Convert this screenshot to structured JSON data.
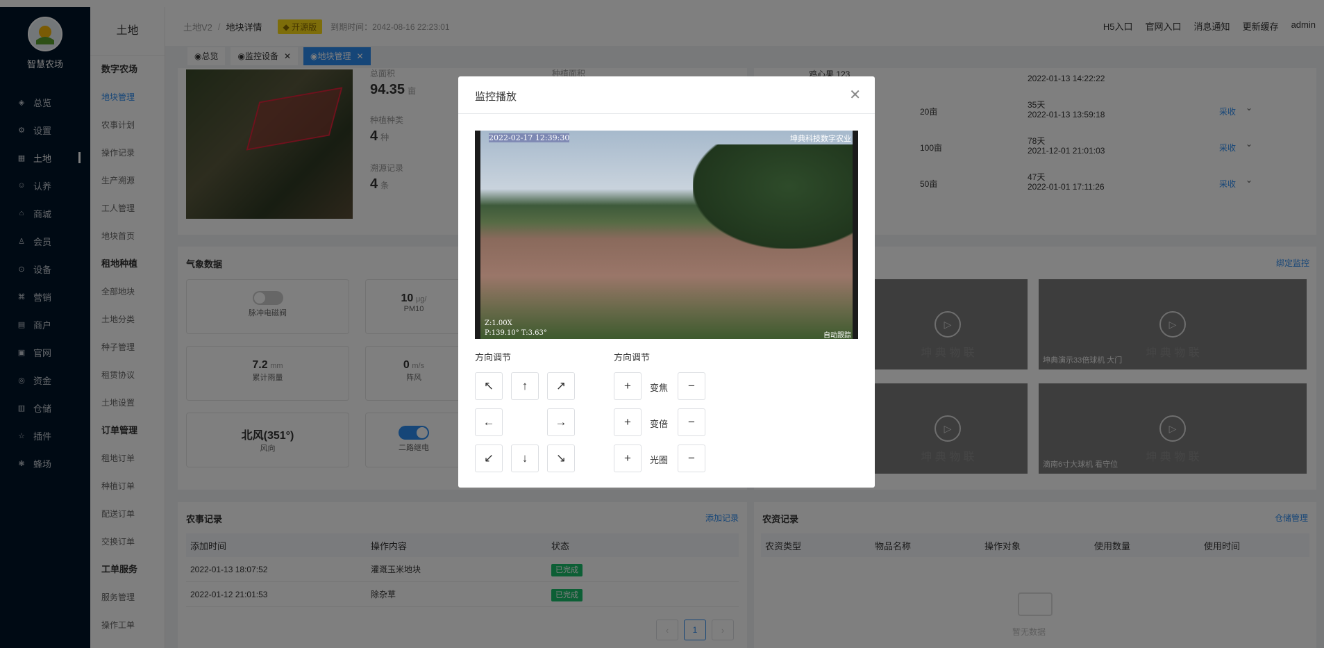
{
  "app": {
    "name": "智慧农场"
  },
  "sidebar": {
    "items": [
      {
        "label": "总览",
        "icon": "dashboard-icon"
      },
      {
        "label": "设置",
        "icon": "gear-icon"
      },
      {
        "label": "土地",
        "icon": "grid-icon"
      },
      {
        "label": "认养",
        "icon": "adopt-icon"
      },
      {
        "label": "商城",
        "icon": "shop-icon"
      },
      {
        "label": "会员",
        "icon": "member-icon"
      },
      {
        "label": "设备",
        "icon": "device-icon"
      },
      {
        "label": "营销",
        "icon": "marketing-icon"
      },
      {
        "label": "商户",
        "icon": "merchant-icon"
      },
      {
        "label": "官网",
        "icon": "website-icon"
      },
      {
        "label": "资金",
        "icon": "fund-icon"
      },
      {
        "label": "仓储",
        "icon": "storage-icon"
      },
      {
        "label": "插件",
        "icon": "star-icon"
      },
      {
        "label": "蜂场",
        "icon": "bee-icon"
      }
    ]
  },
  "subnav": {
    "title": "土地",
    "items": [
      {
        "label": "数字农场",
        "head": true
      },
      {
        "label": "地块管理",
        "active": true
      },
      {
        "label": "农事计划"
      },
      {
        "label": "操作记录"
      },
      {
        "label": "生产溯源"
      },
      {
        "label": "工人管理"
      },
      {
        "label": "地块首页"
      },
      {
        "label": "租地种植",
        "head": true
      },
      {
        "label": "全部地块"
      },
      {
        "label": "土地分类"
      },
      {
        "label": "种子管理"
      },
      {
        "label": "租赁协议"
      },
      {
        "label": "土地设置"
      },
      {
        "label": "订单管理",
        "head": true
      },
      {
        "label": "租地订单"
      },
      {
        "label": "种植订单"
      },
      {
        "label": "配送订单"
      },
      {
        "label": "交换订单"
      },
      {
        "label": "工单服务",
        "head": true
      },
      {
        "label": "服务管理"
      },
      {
        "label": "操作工单"
      }
    ]
  },
  "header": {
    "crumb_root": "土地V2",
    "crumb_sep": "/",
    "crumb_current": "地块详情",
    "edition": "开源版",
    "expire": "到期时间：2042-08-16 22:23:01",
    "links": [
      "H5入口",
      "官网入口",
      "消息通知",
      "更新缓存",
      "admin"
    ]
  },
  "tabs": [
    {
      "label": "◉总览"
    },
    {
      "label": "◉监控设备",
      "close": "✕"
    },
    {
      "label": "◉地块管理",
      "close": "✕",
      "active": true
    }
  ],
  "land": {
    "area_label": "总面积",
    "area_value": "94.35",
    "area_unit": "亩",
    "crop_label": "种植种类",
    "crop_value": "4",
    "crop_unit": "种",
    "trace_label": "溯源记录",
    "trace_value": "4",
    "trace_unit": "条",
    "plant_label": "种植面积"
  },
  "crops": {
    "rows": [
      {
        "name": "鸡心果 123",
        "area": "",
        "days": "",
        "time": "2022-01-13 14:22:22",
        "action": ""
      },
      {
        "name": "",
        "area": "20亩",
        "days": "35天",
        "time": "2022-01-13 13:59:18",
        "action": "采收"
      },
      {
        "name": "",
        "area": "100亩",
        "days": "78天",
        "time": "2021-12-01 21:01:03",
        "action": "采收"
      },
      {
        "name": "",
        "area": "50亩",
        "days": "47天",
        "time": "2022-01-01 17:11:26",
        "action": "采收"
      }
    ]
  },
  "weather": {
    "title": "气象数据",
    "valve_label": "脉冲电磁阀",
    "pm10_value": "10",
    "pm10_unit": "μg/",
    "pm10_label": "PM10",
    "rain_value": "7.2",
    "rain_unit": "mm",
    "rain_label": "累计雨量",
    "gust_value": "0",
    "gust_unit": "m/s",
    "gust_label": "阵风",
    "wind_value": "北风(351°)",
    "wind_label": "风向",
    "relay_label": "二路继电"
  },
  "monitor": {
    "bind_link": "绑定监控",
    "videos": [
      {
        "caption": ""
      },
      {
        "caption": "坤典演示33倍球机 大门"
      },
      {
        "caption": ""
      },
      {
        "caption": "滴南6寸大球机 看守位"
      }
    ],
    "watermark": "坤 典 物 联"
  },
  "farm_records": {
    "title": "农事记录",
    "add_link": "添加记录",
    "columns": [
      "添加时间",
      "操作内容",
      "状态"
    ],
    "rows": [
      {
        "time": "2022-01-13 18:07:52",
        "content": "灌溉玉米地块",
        "status": "已完成"
      },
      {
        "time": "2022-01-12 21:01:53",
        "content": "除杂草",
        "status": "已完成"
      }
    ],
    "page": "1"
  },
  "supply_records": {
    "title": "农资记录",
    "manage_link": "仓储管理",
    "columns": [
      "农资类型",
      "物品名称",
      "操作对象",
      "使用数量",
      "使用时间"
    ],
    "empty": "暂无数据"
  },
  "modal": {
    "title": "监控播放",
    "osd_time": "2022-02-17 12:39:30",
    "osd_brand": "坤典科技数字农业",
    "osd_zoom": "Z:1.00X",
    "osd_ptz": "P:139.10° T:3.63°",
    "osd_mode": "自动跟踪",
    "dir_label": "方向调节",
    "zoom_label": "方向调节",
    "arrows": [
      "↖",
      "↑",
      "↗",
      "←",
      "→",
      "↙",
      "↓",
      "↘"
    ],
    "plus": "+",
    "minus": "−",
    "focus": "变焦",
    "mag": "变倍",
    "iris": "光圈"
  }
}
